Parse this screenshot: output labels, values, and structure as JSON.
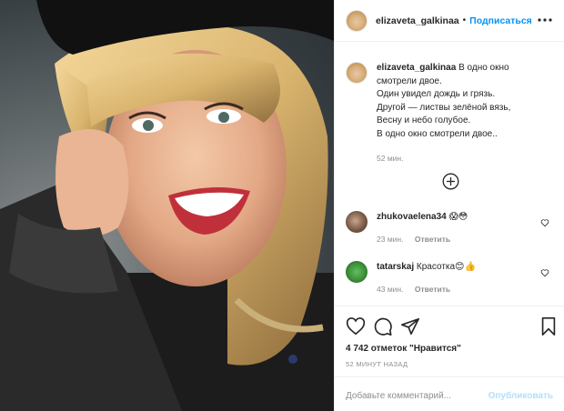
{
  "header": {
    "username": "elizaveta_galkinaa",
    "dot": "•",
    "follow_label": "Подписаться"
  },
  "caption": {
    "username": "elizaveta_galkinaa",
    "lines": [
      "В одно окно",
      "смотрели двое.",
      "Один увидел дождь и грязь.",
      "Другой — листвы зелёной вязь,",
      "Весну и небо голубое.",
      "В одно окно смотрели двое.."
    ],
    "time": "52 мин."
  },
  "comments": [
    {
      "username": "zhukovaelena34",
      "text": "😱😳",
      "time": "23 мин.",
      "reply": "Ответить"
    },
    {
      "username": "tatarskaj",
      "text": "Красотка😊👍",
      "time": "43 мин.",
      "reply": "Ответить"
    }
  ],
  "likes": "4 742 отметок \"Нравится\"",
  "time_ago": "52 МИНУТ НАЗАД",
  "comment_input": {
    "placeholder": "Добавьте комментарий..."
  },
  "publish_label": "Опубликовать",
  "icons": [
    "more-icon",
    "plus-circle-icon",
    "heart-icon",
    "comment-icon",
    "share-icon",
    "bookmark-icon"
  ],
  "colors": {
    "accent": "#0095f6",
    "text": "#262626",
    "muted": "#8e8e8e",
    "border": "#efefef"
  }
}
